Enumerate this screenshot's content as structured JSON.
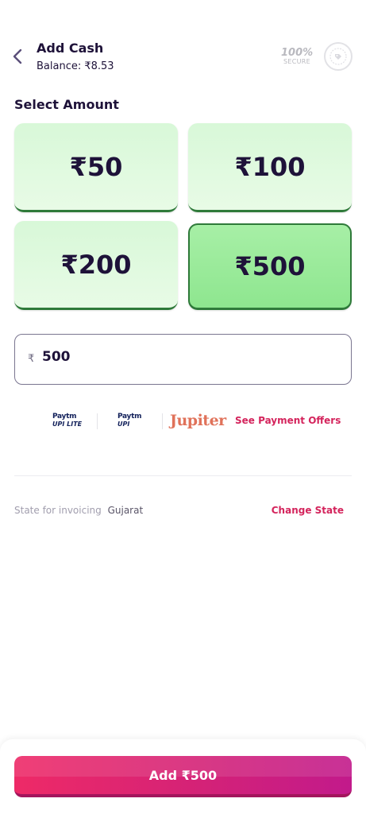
{
  "header": {
    "title": "Add Cash",
    "balance": "Balance: ₹8.53",
    "secure_big": "100%",
    "secure_small": "SECURE"
  },
  "select_label": "Select Amount",
  "amounts": [
    {
      "label": "₹50",
      "selected": false
    },
    {
      "label": "₹100",
      "selected": false
    },
    {
      "label": "₹200",
      "selected": false
    },
    {
      "label": "₹500",
      "selected": true
    }
  ],
  "amount_input": {
    "currency": "₹",
    "value": "500"
  },
  "payment_offers": {
    "paytm_upi_lite": {
      "brand": "Paytm",
      "sub": "UPI LITE"
    },
    "paytm_upi": {
      "brand": "Paytm",
      "sub": "UPI"
    },
    "jupiter": "Jupiter",
    "see_offers": "See Payment Offers"
  },
  "invoice": {
    "label": "State for invoicing",
    "state": "Gujarat",
    "change": "Change State"
  },
  "cta": {
    "label": "Add ₹500"
  },
  "colors": {
    "accent": "#d4245c",
    "selected_fill": "#9aeb9b",
    "tile_fill": "#e1fae0",
    "text_dark": "#1e1239"
  },
  "icons": {
    "back": "chevron-left-icon",
    "secure_badge": "secure-badge-icon"
  }
}
